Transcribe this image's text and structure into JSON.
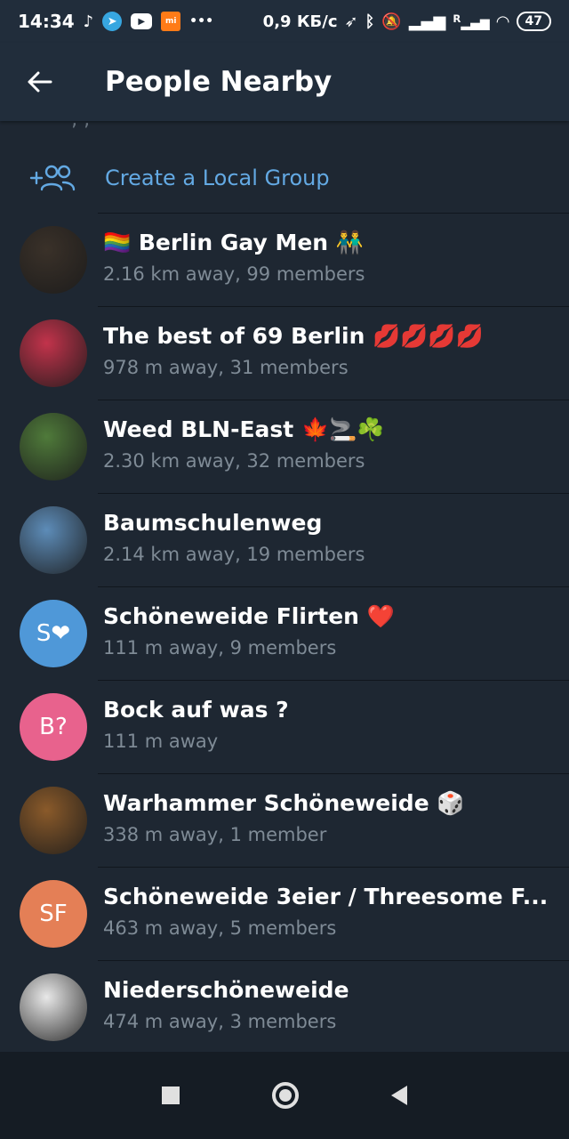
{
  "status_bar": {
    "time": "14:34",
    "speed": "0,9 КБ/с",
    "battery": "47",
    "roaming": "R"
  },
  "app_bar": {
    "back_icon": "arrow-left-icon",
    "title": "People Nearby"
  },
  "create_group": {
    "icon": "add-group-icon",
    "label": "Create a Local Group"
  },
  "groups": [
    {
      "name": "Berlin Gay Men",
      "prefix_emoji": "🏳️‍🌈",
      "suffix_emoji": "👬",
      "meta": "2.16 km away, 99 members",
      "avatar_initials": "",
      "avatar_color": "#3a3129"
    },
    {
      "name": "The best of 69 Berlin",
      "prefix_emoji": "",
      "suffix_emoji": "💋💋💋💋",
      "meta": "978 m away, 31 members",
      "avatar_initials": "",
      "avatar_color": "#c2334b"
    },
    {
      "name": "Weed BLN-East",
      "prefix_emoji": "",
      "suffix_emoji": "🍁🚬☘️",
      "meta": "2.30 km away, 32 members",
      "avatar_initials": "",
      "avatar_color": "#4f7a3a"
    },
    {
      "name": "Baumschulenweg",
      "prefix_emoji": "",
      "suffix_emoji": "",
      "meta": "2.14 km away, 19 members",
      "avatar_initials": "",
      "avatar_color": "#5d8cb8"
    },
    {
      "name": "Schöneweide Flirten",
      "prefix_emoji": "",
      "suffix_emoji": "❤️",
      "meta": "111 m away, 9 members",
      "avatar_initials": "S❤",
      "avatar_color": "#4f98d8"
    },
    {
      "name": "Bock auf was ?",
      "prefix_emoji": "",
      "suffix_emoji": "",
      "meta": "111 m away",
      "avatar_initials": "B?",
      "avatar_color": "#e8628d"
    },
    {
      "name": "Warhammer Schöneweide",
      "prefix_emoji": "",
      "suffix_emoji": "🎲",
      "meta": "338 m away, 1 member",
      "avatar_initials": "",
      "avatar_color": "#8a5a2a"
    },
    {
      "name": "Schöneweide 3eier / Threesome F...",
      "prefix_emoji": "",
      "suffix_emoji": "",
      "meta": "463 m away, 5 members",
      "avatar_initials": "SF",
      "avatar_color": "#e47f56"
    },
    {
      "name": "Niederschöneweide",
      "prefix_emoji": "",
      "suffix_emoji": "",
      "meta": "474 m away, 3 members",
      "avatar_initials": "",
      "avatar_color": "#e8e8e8"
    }
  ],
  "nav_bar": {
    "recents_icon": "square-icon",
    "home_icon": "circle-icon",
    "back_icon": "triangle-back-icon"
  },
  "colors": {
    "background": "#1e2732",
    "header": "#212d3b",
    "accent": "#63a9e3",
    "secondary_text": "#7f8b96"
  }
}
